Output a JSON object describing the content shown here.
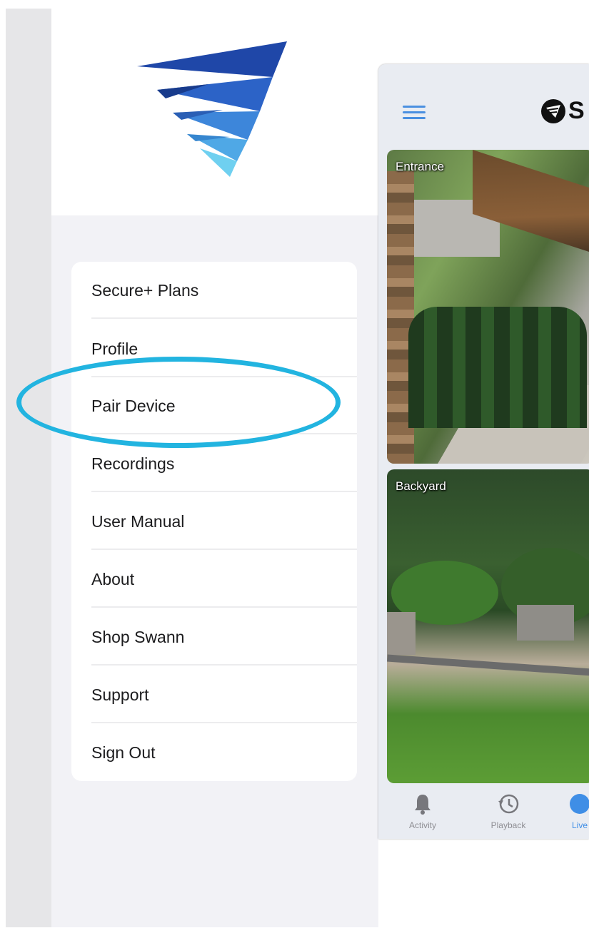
{
  "menu": {
    "items": [
      {
        "label": "Secure+ Plans"
      },
      {
        "label": "Profile"
      },
      {
        "label": "Pair Device"
      },
      {
        "label": "Recordings"
      },
      {
        "label": "User Manual"
      },
      {
        "label": "About"
      },
      {
        "label": "Shop Swann"
      },
      {
        "label": "Support"
      },
      {
        "label": "Sign Out"
      }
    ],
    "highlighted_item": "Pair Device"
  },
  "app": {
    "brand_partial": "S",
    "cameras": [
      {
        "label": "Entrance"
      },
      {
        "label": "Backyard"
      }
    ],
    "tabs": [
      {
        "label": "Activity",
        "icon": "bell-icon"
      },
      {
        "label": "Playback",
        "icon": "history-icon"
      },
      {
        "label": "Live",
        "icon": "live-icon",
        "visible_label": "Live",
        "active": true
      }
    ]
  },
  "colors": {
    "highlight_ring": "#22b4e0",
    "accent": "#3f8ee6",
    "logo_dark": "#1f47a8",
    "logo_light": "#6fd0f0"
  }
}
